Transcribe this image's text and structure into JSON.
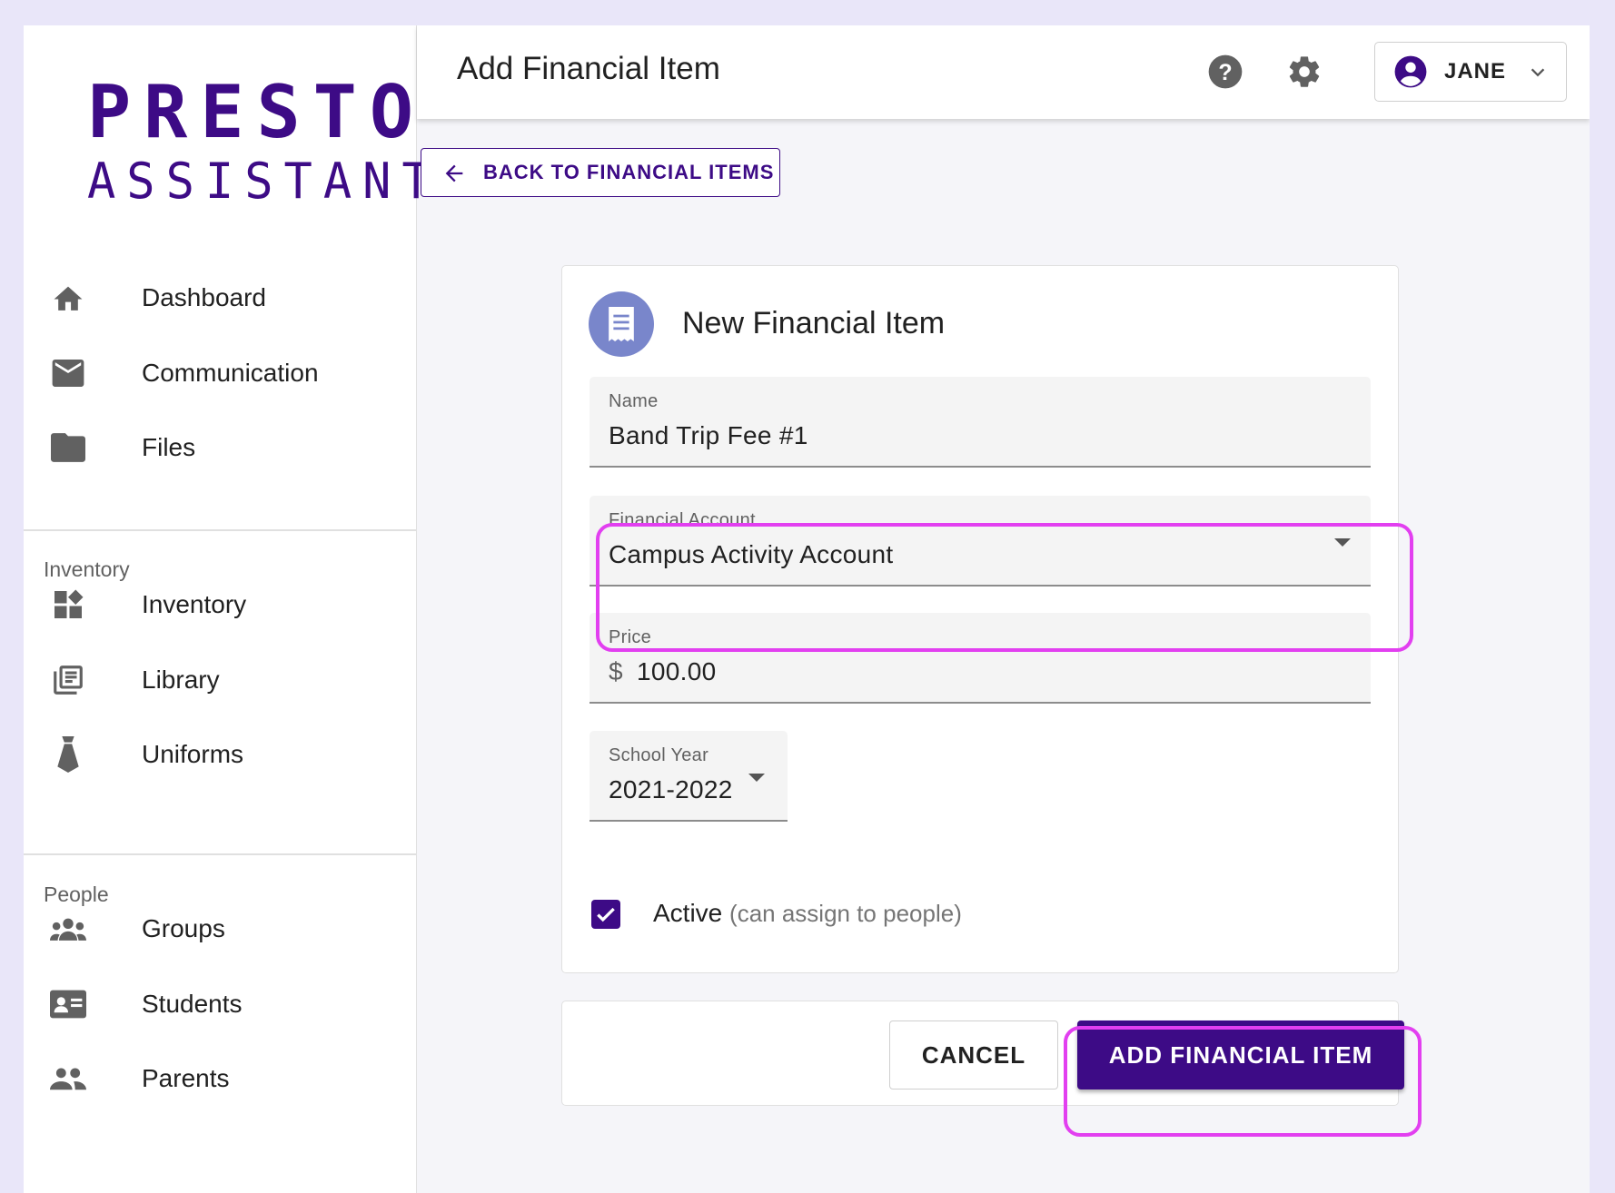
{
  "brand": {
    "logo_top": "PRESTO",
    "logo_bottom": "ASSISTANT",
    "color": "#3d0b86"
  },
  "header": {
    "title": "Add Financial Item",
    "user_name": "JANE"
  },
  "sidebar": {
    "main_items": [
      {
        "label": "Dashboard",
        "icon": "home-icon"
      },
      {
        "label": "Communication",
        "icon": "mail-icon"
      },
      {
        "label": "Files",
        "icon": "folder-icon"
      }
    ],
    "inventory_section": {
      "title": "Inventory",
      "items": [
        {
          "label": "Inventory",
          "icon": "widgets-icon"
        },
        {
          "label": "Library",
          "icon": "library-icon"
        },
        {
          "label": "Uniforms",
          "icon": "tie-icon"
        }
      ]
    },
    "people_section": {
      "title": "People",
      "items": [
        {
          "label": "Groups",
          "icon": "groups-icon"
        },
        {
          "label": "Students",
          "icon": "id-card-icon"
        },
        {
          "label": "Parents",
          "icon": "people-icon"
        }
      ]
    }
  },
  "back_button": {
    "label": "BACK TO FINANCIAL ITEMS"
  },
  "form": {
    "title": "New Financial Item",
    "name": {
      "label": "Name",
      "value": "Band Trip Fee #1"
    },
    "financial_account": {
      "label": "Financial Account",
      "value": "Campus Activity Account"
    },
    "price": {
      "label": "Price",
      "prefix": "$",
      "value": "100.00"
    },
    "school_year": {
      "label": "School Year",
      "value": "2021-2022"
    },
    "active": {
      "label": "Active",
      "hint": "(can assign to people)",
      "checked": true
    }
  },
  "actions": {
    "cancel_label": "CANCEL",
    "submit_label": "ADD FINANCIAL ITEM"
  },
  "colors": {
    "primary": "#3d0b86",
    "highlight": "#e23ff0",
    "avatar": "#7986cb",
    "icon_gray": "#616161"
  }
}
